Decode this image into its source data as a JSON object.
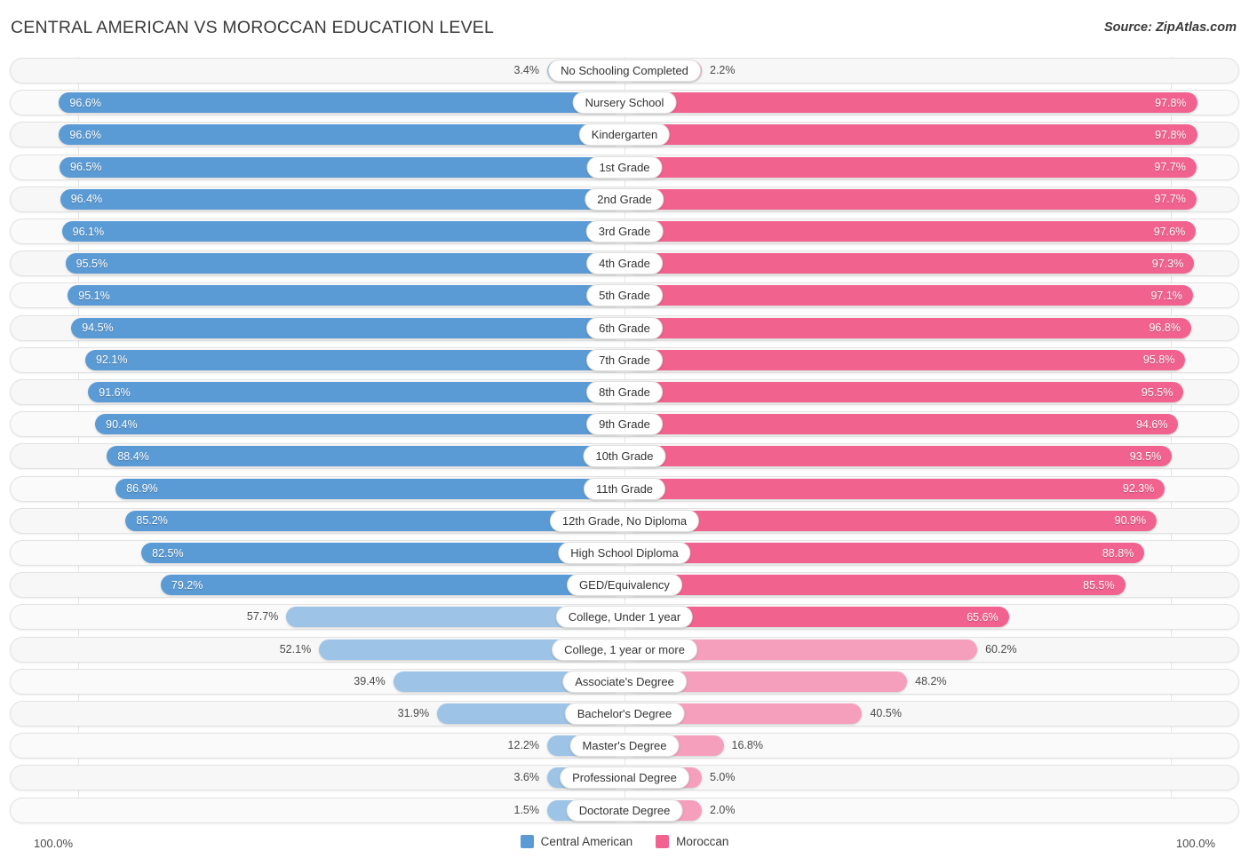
{
  "header": {
    "title": "CENTRAL AMERICAN VS MOROCCAN EDUCATION LEVEL",
    "source": "Source: ZipAtlas.com"
  },
  "footer": {
    "axis_left": "100.0%",
    "axis_right": "100.0%",
    "legend": [
      {
        "label": "Central American",
        "color": "#5b9bd5"
      },
      {
        "label": "Moroccan",
        "color": "#f2628f"
      }
    ]
  },
  "colors": {
    "left_strong": "#5b9bd5",
    "left_light": "#9dc3e6",
    "right_strong": "#f2628f",
    "right_light": "#f59fbc",
    "row_bg": "#f7f7f7",
    "row_border": "#e2e2e2",
    "text_dark": "#3a3a3a"
  },
  "chart_data": {
    "type": "bar",
    "subtype": "diverging-paired-bar",
    "title": "CENTRAL AMERICAN VS MOROCCAN EDUCATION LEVEL",
    "xlabel": "",
    "ylabel": "",
    "xlim": [
      0,
      100
    ],
    "unit": "%",
    "grid": false,
    "legend_position": "bottom-center",
    "categories": [
      "No Schooling Completed",
      "Nursery School",
      "Kindergarten",
      "1st Grade",
      "2nd Grade",
      "3rd Grade",
      "4th Grade",
      "5th Grade",
      "6th Grade",
      "7th Grade",
      "8th Grade",
      "9th Grade",
      "10th Grade",
      "11th Grade",
      "12th Grade, No Diploma",
      "High School Diploma",
      "GED/Equivalency",
      "College, Under 1 year",
      "College, 1 year or more",
      "Associate's Degree",
      "Bachelor's Degree",
      "Master's Degree",
      "Professional Degree",
      "Doctorate Degree"
    ],
    "series": [
      {
        "name": "Central American",
        "side": "left",
        "color": "#5b9bd5",
        "values": [
          3.4,
          96.6,
          96.6,
          96.5,
          96.4,
          96.1,
          95.5,
          95.1,
          94.5,
          92.1,
          91.6,
          90.4,
          88.4,
          86.9,
          85.2,
          82.5,
          79.2,
          57.7,
          52.1,
          39.4,
          31.9,
          12.2,
          3.6,
          1.5
        ]
      },
      {
        "name": "Moroccan",
        "side": "right",
        "color": "#f2628f",
        "values": [
          2.2,
          97.8,
          97.8,
          97.7,
          97.7,
          97.6,
          97.3,
          97.1,
          96.8,
          95.8,
          95.5,
          94.6,
          93.5,
          92.3,
          90.9,
          88.8,
          85.5,
          65.6,
          60.2,
          48.2,
          40.5,
          16.8,
          5.0,
          2.0
        ]
      }
    ]
  },
  "rows": [
    {
      "label": "No Schooling Completed",
      "left": "3.4%",
      "right": "2.2%",
      "lv": 3.4,
      "rv": 2.2
    },
    {
      "label": "Nursery School",
      "left": "96.6%",
      "right": "97.8%",
      "lv": 96.6,
      "rv": 97.8
    },
    {
      "label": "Kindergarten",
      "left": "96.6%",
      "right": "97.8%",
      "lv": 96.6,
      "rv": 97.8
    },
    {
      "label": "1st Grade",
      "left": "96.5%",
      "right": "97.7%",
      "lv": 96.5,
      "rv": 97.7
    },
    {
      "label": "2nd Grade",
      "left": "96.4%",
      "right": "97.7%",
      "lv": 96.4,
      "rv": 97.7
    },
    {
      "label": "3rd Grade",
      "left": "96.1%",
      "right": "97.6%",
      "lv": 96.1,
      "rv": 97.6
    },
    {
      "label": "4th Grade",
      "left": "95.5%",
      "right": "97.3%",
      "lv": 95.5,
      "rv": 97.3
    },
    {
      "label": "5th Grade",
      "left": "95.1%",
      "right": "97.1%",
      "lv": 95.1,
      "rv": 97.1
    },
    {
      "label": "6th Grade",
      "left": "94.5%",
      "right": "96.8%",
      "lv": 94.5,
      "rv": 96.8
    },
    {
      "label": "7th Grade",
      "left": "92.1%",
      "right": "95.8%",
      "lv": 92.1,
      "rv": 95.8
    },
    {
      "label": "8th Grade",
      "left": "91.6%",
      "right": "95.5%",
      "lv": 91.6,
      "rv": 95.5
    },
    {
      "label": "9th Grade",
      "left": "90.4%",
      "right": "94.6%",
      "lv": 90.4,
      "rv": 94.6
    },
    {
      "label": "10th Grade",
      "left": "88.4%",
      "right": "93.5%",
      "lv": 88.4,
      "rv": 93.5
    },
    {
      "label": "11th Grade",
      "left": "86.9%",
      "right": "92.3%",
      "lv": 86.9,
      "rv": 92.3
    },
    {
      "label": "12th Grade, No Diploma",
      "left": "85.2%",
      "right": "90.9%",
      "lv": 85.2,
      "rv": 90.9
    },
    {
      "label": "High School Diploma",
      "left": "82.5%",
      "right": "88.8%",
      "lv": 82.5,
      "rv": 88.8
    },
    {
      "label": "GED/Equivalency",
      "left": "79.2%",
      "right": "85.5%",
      "lv": 79.2,
      "rv": 85.5
    },
    {
      "label": "College, Under 1 year",
      "left": "57.7%",
      "right": "65.6%",
      "lv": 57.7,
      "rv": 65.6
    },
    {
      "label": "College, 1 year or more",
      "left": "52.1%",
      "right": "60.2%",
      "lv": 52.1,
      "rv": 60.2
    },
    {
      "label": "Associate's Degree",
      "left": "39.4%",
      "right": "48.2%",
      "lv": 39.4,
      "rv": 48.2
    },
    {
      "label": "Bachelor's Degree",
      "left": "31.9%",
      "right": "40.5%",
      "lv": 31.9,
      "rv": 40.5
    },
    {
      "label": "Master's Degree",
      "left": "12.2%",
      "right": "16.8%",
      "lv": 12.2,
      "rv": 16.8
    },
    {
      "label": "Professional Degree",
      "left": "3.6%",
      "right": "5.0%",
      "lv": 3.6,
      "rv": 5.0
    },
    {
      "label": "Doctorate Degree",
      "left": "1.5%",
      "right": "2.0%",
      "lv": 1.5,
      "rv": 2.0
    }
  ]
}
